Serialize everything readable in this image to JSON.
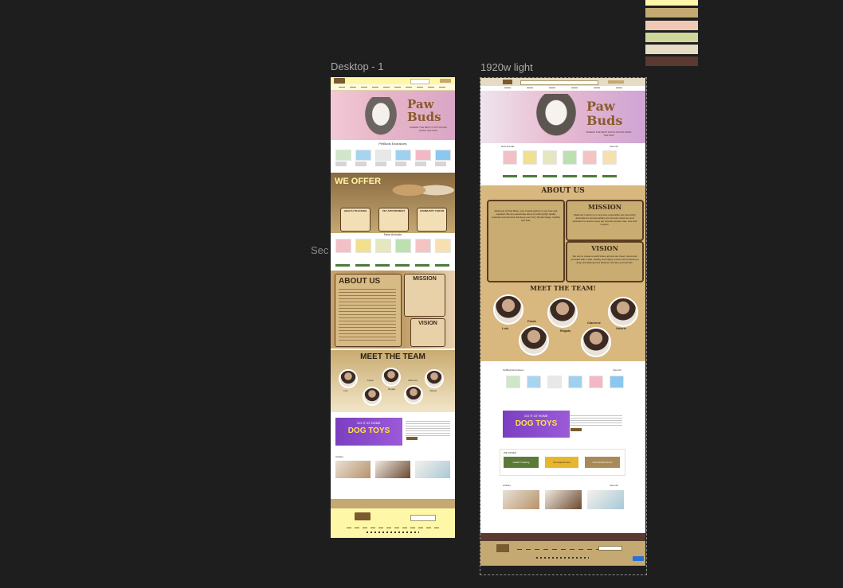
{
  "canvas": {
    "left_frame_label": "Desktop - 1",
    "right_frame_label": "1920w light",
    "partial_label": "Sec"
  },
  "swatches": [
    "#fff7a8",
    "#c4a973",
    "#efc9b5",
    "#cfd69a",
    "#e6dbc3",
    "#5a3a30"
  ],
  "desktop1": {
    "brand": "PawBuds",
    "hero": {
      "title_a": "Paw",
      "title_b": "Buds",
      "tagline": "WHERE THE BEST PUPS ROVES PAWS THE PAW"
    },
    "exclusives_title": "PetBuds Exclusives",
    "offer": {
      "title": "WE OFFER",
      "items": [
        "HEALTH TRACKING",
        "VET APPOINTMENT",
        "COMMUNITY FORUM"
      ]
    },
    "new_arrivals_title": "New Arrivals",
    "about": {
      "title": "ABOUT US",
      "mission": "MISSION",
      "vision": "VISION"
    },
    "team": {
      "title": "MEET THE TEAM",
      "members": [
        "Lois",
        "Farah",
        "Regals",
        "Clarence",
        "Valerie"
      ]
    },
    "promo": {
      "line1": "DO IT AT HOME",
      "line2": "DOG TOYS"
    },
    "articles_title": "Articles",
    "footer_brand": "PawBuds"
  },
  "light": {
    "brand": "PawBuds",
    "hero": {
      "title_a": "Paw",
      "title_b": "Buds",
      "tagline": "WHERE THE BEST DOGS ROVES PAWS THE PAW"
    },
    "new_arrivals_title": "New Arrivals",
    "view_all": "View All",
    "about": {
      "title": "ABOUT US",
      "mission": "MISSION",
      "vision": "VISION",
      "body": "Welcome to Paw Buds, your trusted partner in pet care and supplies! We are passionate about providing high quality products and services that keep your furry friends happy, healthy and safe.",
      "mission_body": "Pawbuds' mission is to promote responsible pet ownership, advocate for animal welfare and provide resources and education to ensure every pet receives proper care, love and respect.",
      "vision_body": "We aim to create a world where all pets are loved, cared and provided with a safe, healthy and happy environment fostering a deep and lasting bond between humans and animals."
    },
    "team": {
      "title": "MEET THE TEAM!",
      "members": [
        "Lois",
        "Farah",
        "Regals",
        "Clarence",
        "Valerie"
      ]
    },
    "exclusives_title": "PetBuds Exclusives",
    "promo": {
      "line1": "DO IT AT HOME",
      "line2": "DOG TOYS"
    },
    "we_offer_title": "WE OFFER",
    "offer_items": [
      "Health Tracking",
      "Vet Appointment",
      "Community Forum"
    ],
    "articles_title": "Articles",
    "footer_brand": "PawBuds"
  }
}
